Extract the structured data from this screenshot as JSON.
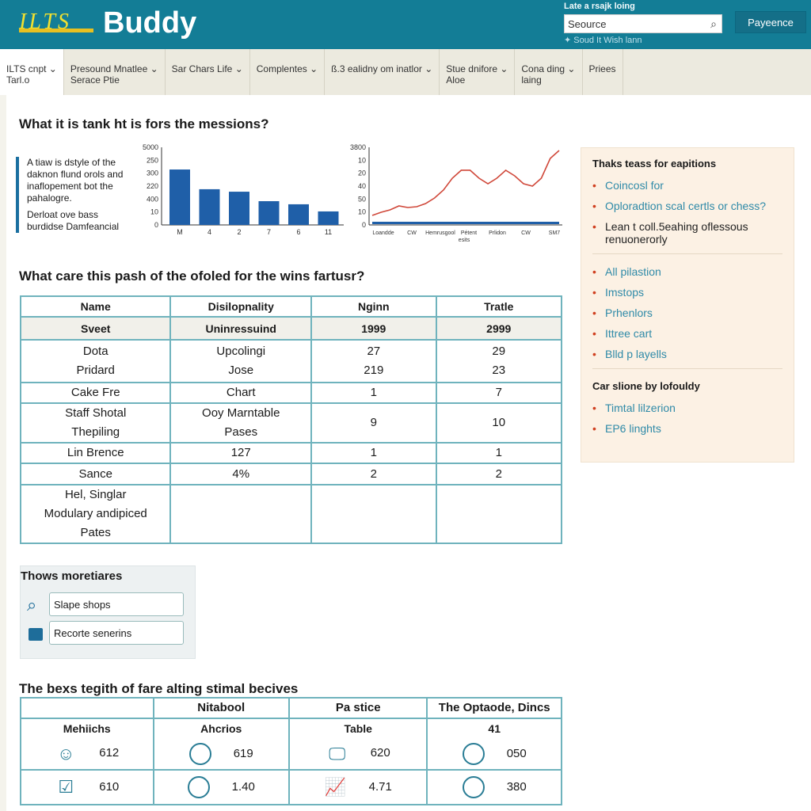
{
  "header": {
    "logo_ilts": "ILTS",
    "logo_buddy": "Buddy",
    "top_note": "Late a rsajk loing",
    "search_placeholder": "Seource",
    "pay_label": "Payeence",
    "sub_link": "Soud It Wish lann"
  },
  "nav": [
    {
      "label": "ILTS cnpt ⌄",
      "label2": "Tarl.o"
    },
    {
      "label": "Presound Mnatlee ⌄",
      "label2": "Serace Ptie"
    },
    {
      "label": "Sar Chars Life ⌄",
      "label2": ""
    },
    {
      "label": "Complentes ⌄",
      "label2": ""
    },
    {
      "label": "ß.3 ealidny om inatlor ⌄",
      "label2": ""
    },
    {
      "label": "Stue dnifore ⌄",
      "label2": "Aloe"
    },
    {
      "label": "Cona ding ⌄",
      "label2": "laing"
    },
    {
      "label": "Priees",
      "label2": ""
    }
  ],
  "section1": {
    "title": "What it is tank ht is fors the messions?",
    "text1": "A tiaw is dstyle of the daknon flund orols and inaflopement bot the pahalogre.",
    "text2": "Derloat ove bass burdidse Damfeancial"
  },
  "bar_chart": {
    "type": "bar",
    "y_ticks": [
      "5000",
      "250",
      "300",
      "220",
      "400",
      "10",
      "0"
    ],
    "categories": [
      "M",
      "4",
      "2",
      "7",
      "6",
      "11"
    ],
    "values": [
      3570,
      2300,
      2140,
      1530,
      1330,
      870
    ],
    "ylim": [
      0,
      5000
    ],
    "color": "#1f5fa8"
  },
  "line_chart": {
    "type": "line",
    "y_ticks": [
      "3800",
      "10",
      "20",
      "40",
      "50",
      "10",
      "0"
    ],
    "x_labels": [
      "Loandde",
      "CW",
      "Hemrusgool",
      "Pétent",
      "Prlidon",
      "CW",
      "SM7"
    ],
    "x_sub": "esits",
    "values": [
      465,
      620,
      737,
      930,
      853,
      892,
      1047,
      1318,
      1706,
      2288,
      2676,
      2676,
      2288,
      2016,
      2288,
      2676,
      2404,
      2016,
      1900,
      2288,
      3257,
      3645
    ],
    "ylim": [
      0,
      3800
    ],
    "color": "#d0483a"
  },
  "panel": {
    "title": "Thaks teass for eapitions",
    "items1": [
      "Coincosl for",
      "Oploradtion scal certls or chess?",
      "Lean t coll.5eahing oflessous renuonerorly"
    ],
    "items2": [
      "All pilastion",
      "Imstops",
      "Prhenlors",
      "Ittree cart",
      "Blld p layells"
    ],
    "title2": "Car slione by lofouldy",
    "items3": [
      "Timtal lilzerion",
      "EP6 linghts"
    ]
  },
  "section2": {
    "title": "What care this pash of the ofoled for the wins fartusr?",
    "headers": [
      "Name",
      "Disilopnality",
      "Nginn",
      "Tratle"
    ],
    "rows": [
      [
        "Sveet",
        "Uninressuind",
        "1999",
        "2999"
      ],
      [
        "Dota\nPridard",
        "Upcolingi\nJose",
        "27\n219",
        "29\n23"
      ],
      [
        "Cake Fre",
        "Chart",
        "1",
        "7"
      ],
      [
        "Staff Shotal\nThepiling",
        "Ooy Marntable\nPases",
        "9",
        "10"
      ],
      [
        "Lin Brence",
        "127",
        "1",
        "1"
      ],
      [
        "Sance",
        "4%",
        "2",
        "2"
      ],
      [
        "Hel, Singlar\nModulary andipiced\nPates",
        "",
        "",
        ""
      ]
    ]
  },
  "filters": {
    "title": "Thows moretiares",
    "search_value": "Slape shops",
    "recent_value": "Recorte senerins"
  },
  "section3": {
    "title": "The bexs tegith of fare alting stimal becives",
    "headers": [
      "",
      "Nitabool",
      "Pa stice",
      "The Optaode, Dincs"
    ],
    "subheaders": [
      "Mehiichs",
      "Ahcrios",
      "Table",
      "41"
    ],
    "rows": [
      [
        "612",
        "619",
        "620",
        "050"
      ],
      [
        "610",
        "1.40",
        "4.71",
        "380"
      ]
    ]
  }
}
